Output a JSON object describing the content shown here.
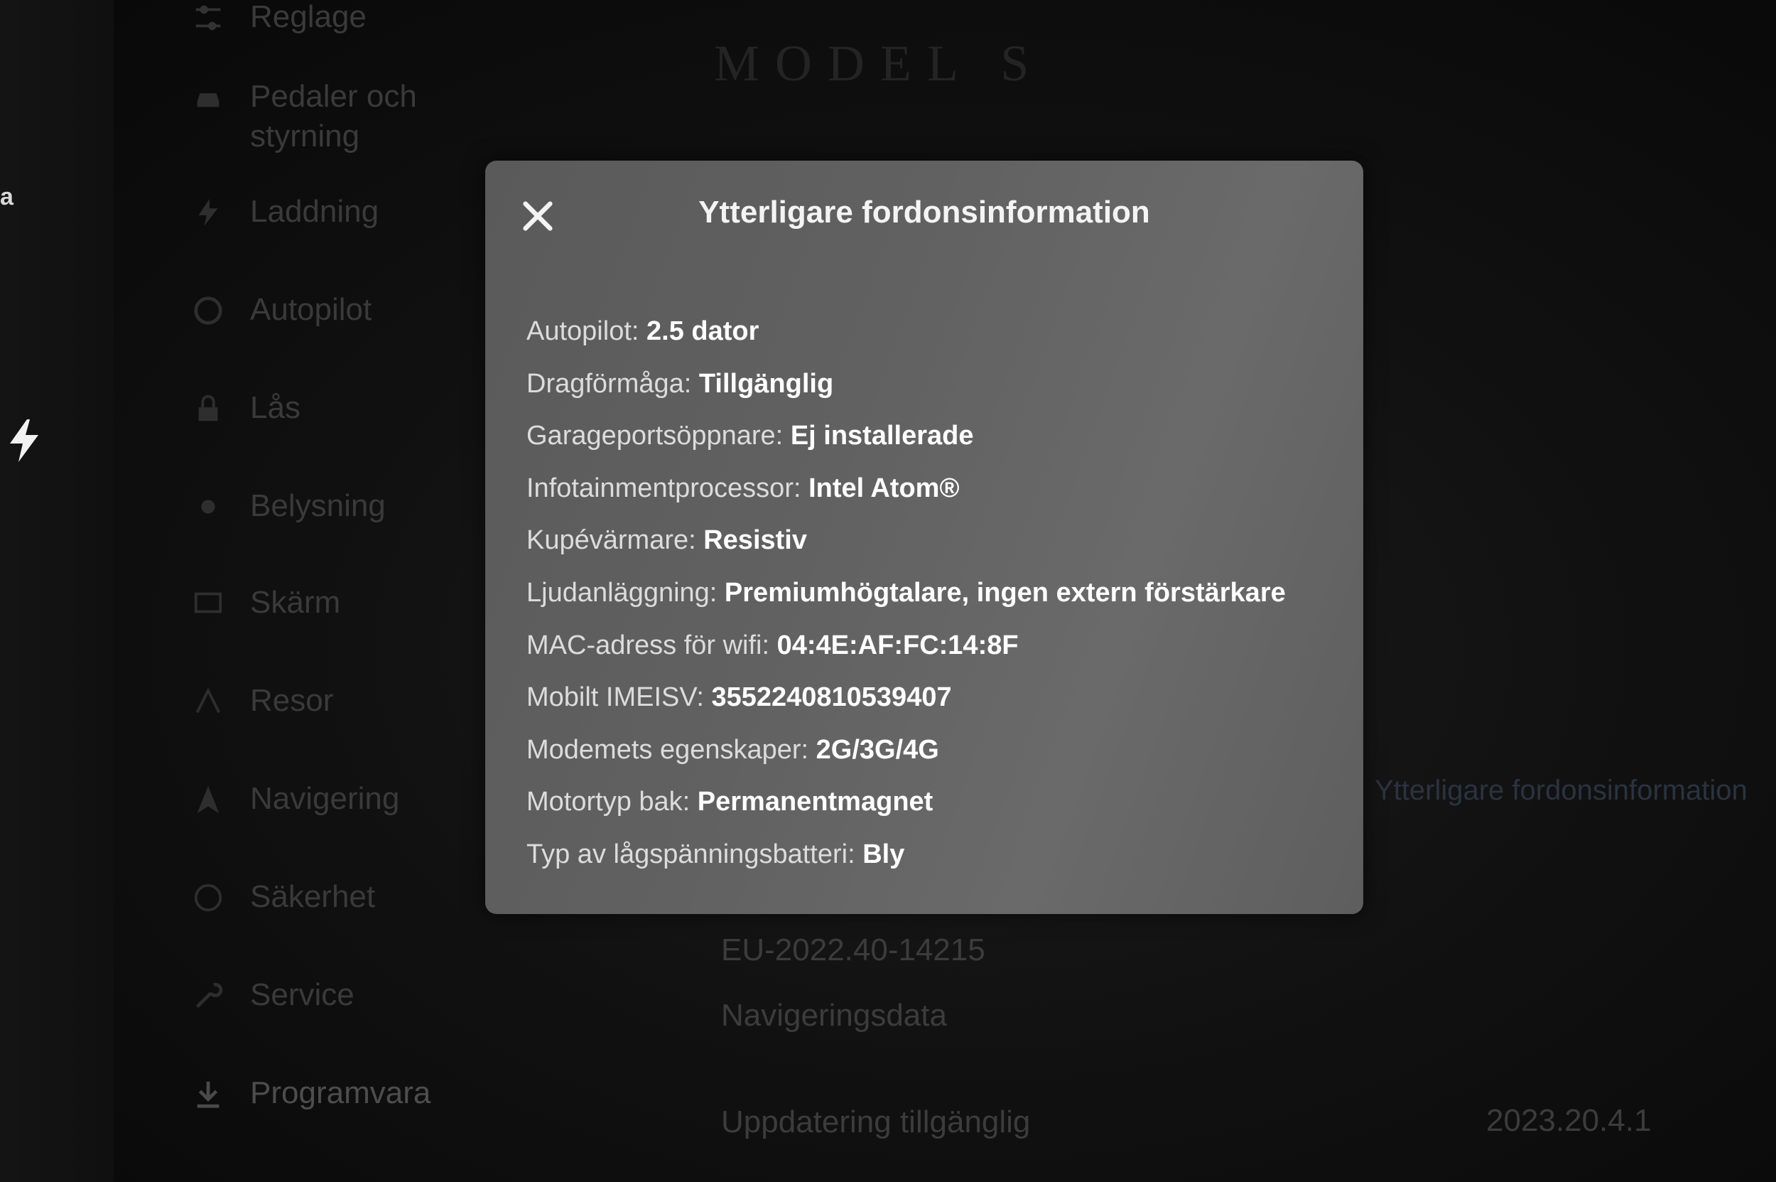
{
  "sidebar_strip": {
    "partial_letter": "a",
    "bolt_icon": "lightning-bolt-icon"
  },
  "menu": {
    "items": [
      {
        "label": "Reglage",
        "icon": "sliders-icon"
      },
      {
        "label": "Pedaler och styrning",
        "icon": "car-icon"
      },
      {
        "label": "Laddning",
        "icon": "charging-icon"
      },
      {
        "label": "Autopilot",
        "icon": "steering-wheel-icon"
      },
      {
        "label": "Lås",
        "icon": "lock-icon"
      },
      {
        "label": "Belysning",
        "icon": "light-icon"
      },
      {
        "label": "Skärm",
        "icon": "display-icon"
      },
      {
        "label": "Resor",
        "icon": "trips-icon"
      },
      {
        "label": "Navigering",
        "icon": "navigation-icon"
      },
      {
        "label": "Säkerhet",
        "icon": "safety-icon"
      },
      {
        "label": "Service",
        "icon": "wrench-icon"
      },
      {
        "label": "Programvara",
        "icon": "download-icon"
      }
    ]
  },
  "content": {
    "model_title": "MODEL S",
    "right_link": "Ytterligare fordonsinformation",
    "software_version": "EU-2022.40-14215",
    "nav_data_label": "Navigeringsdata",
    "update_label": "Uppdatering tillgänglig",
    "update_version": "2023.20.4.1"
  },
  "modal": {
    "title": "Ytterligare fordonsinformation",
    "close_icon": "close-icon",
    "rows": [
      {
        "label": "Autopilot:",
        "value": "2.5 dator"
      },
      {
        "label": "Dragförmåga:",
        "value": "Tillgänglig"
      },
      {
        "label": "Garageportsöppnare:",
        "value": "Ej installerade"
      },
      {
        "label": "Infotainmentprocessor:",
        "value": "Intel Atom®"
      },
      {
        "label": "Kupévärmare:",
        "value": "Resistiv"
      },
      {
        "label": "Ljudanläggning:",
        "value": "Premiumhögtalare, ingen extern förstärkare"
      },
      {
        "label": "MAC-adress för wifi:",
        "value": "04:4E:AF:FC:14:8F"
      },
      {
        "label": "Mobilt IMEISV:",
        "value": "3552240810539407"
      },
      {
        "label": "Modemets egenskaper:",
        "value": "2G/3G/4G"
      },
      {
        "label": "Motortyp bak:",
        "value": "Permanentmagnet"
      },
      {
        "label": "Typ av lågspänningsbatteri:",
        "value": "Bly"
      }
    ]
  }
}
